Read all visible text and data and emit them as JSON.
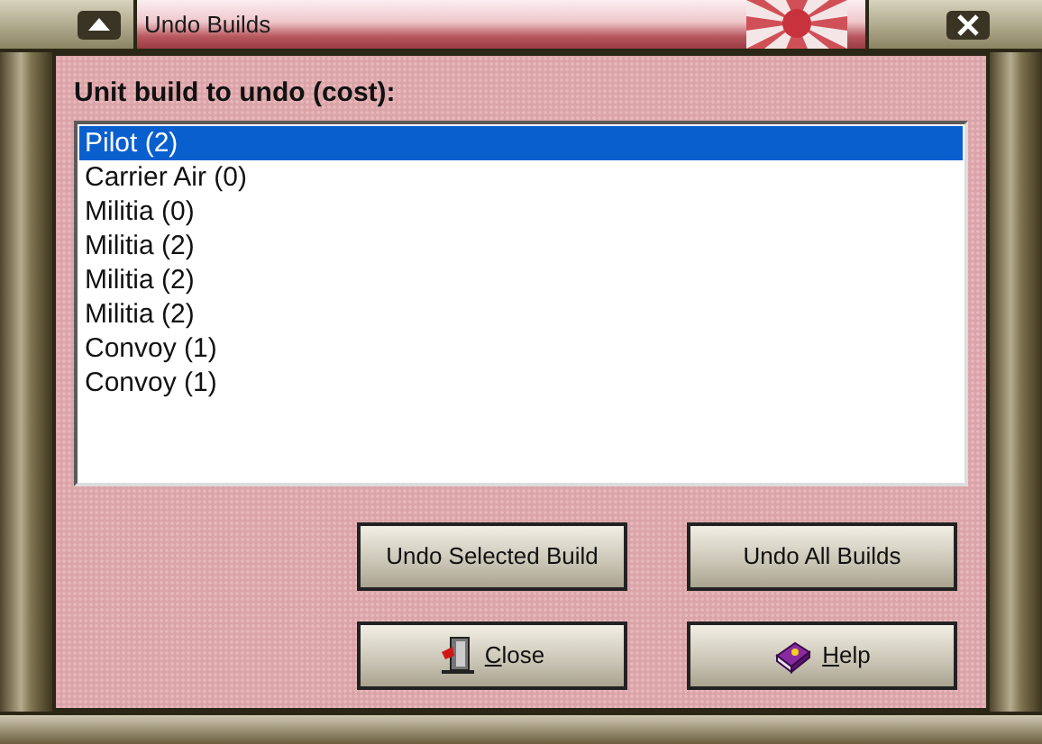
{
  "window": {
    "title": "Undo Builds"
  },
  "prompt": "Unit build to undo (cost):",
  "units": [
    {
      "label": "Pilot (2)",
      "selected": true
    },
    {
      "label": "Carrier Air (0)",
      "selected": false
    },
    {
      "label": "Militia (0)",
      "selected": false
    },
    {
      "label": "Militia (2)",
      "selected": false
    },
    {
      "label": "Militia (2)",
      "selected": false
    },
    {
      "label": "Militia (2)",
      "selected": false
    },
    {
      "label": "Convoy (1)",
      "selected": false
    },
    {
      "label": "Convoy (1)",
      "selected": false
    }
  ],
  "buttons": [
    {
      "label": "Undo Selected Build",
      "kind": "plain",
      "mnemonic": false
    },
    {
      "label": "Undo All Builds",
      "kind": "plain",
      "mnemonic": false
    },
    {
      "label": "Close",
      "kind": "close",
      "mnemonic": true
    },
    {
      "label": "Help",
      "kind": "help",
      "mnemonic": true
    }
  ]
}
